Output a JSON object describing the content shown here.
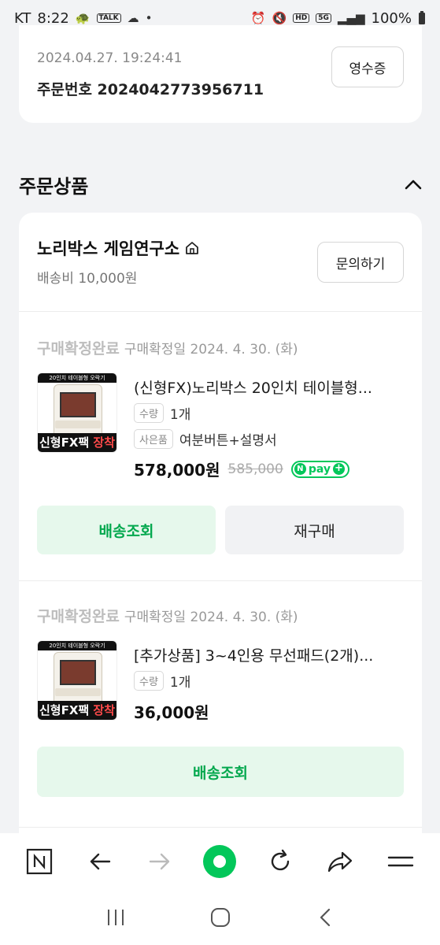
{
  "status_bar": {
    "carrier": "KT",
    "time": "8:22",
    "battery": "100%",
    "network": "5G",
    "hd_badge": "HD",
    "talk_badge": "TALK"
  },
  "order": {
    "datetime": "2024.04.27. 19:24:41",
    "number_label": "주문번호 2024042773956711",
    "receipt_label": "영수증"
  },
  "section": {
    "title": "주문상품"
  },
  "seller": {
    "name": "노리박스 게임연구소",
    "shipping_fee": "배송비 10,000원",
    "inquiry_label": "문의하기"
  },
  "items": [
    {
      "status": "구매확정완료",
      "confirm_date": "구매확정일 2024. 4. 30. (화)",
      "thumb_top": "20인치 테이블형 오락기",
      "thumb_bottom_a": "신형FX팩",
      "thumb_bottom_b": "장착",
      "name": "(신형FX)노리박스 20인치 테이블형...",
      "qty_tag": "수량",
      "qty": "1개",
      "gift_tag": "사은품",
      "gift": "여분버튼+설명서",
      "price": "578,000원",
      "original_price": "585,000",
      "npay_label": "pay",
      "track_label": "배송조회",
      "reorder_label": "재구매"
    },
    {
      "status": "구매확정완료",
      "confirm_date": "구매확정일 2024. 4. 30. (화)",
      "thumb_top": "20인치 테이블형 오락기",
      "thumb_bottom_a": "신형FX팩",
      "thumb_bottom_b": "장착",
      "name": "[추가상품] 3~4인용 무선패드(2개)...",
      "qty_tag": "수량",
      "qty": "1개",
      "price": "36,000원",
      "track_label": "배송조회"
    }
  ],
  "colors": {
    "accent_green": "#03c75a",
    "button_green_bg": "#e6f8ec",
    "page_bg": "#f2f3f5"
  }
}
